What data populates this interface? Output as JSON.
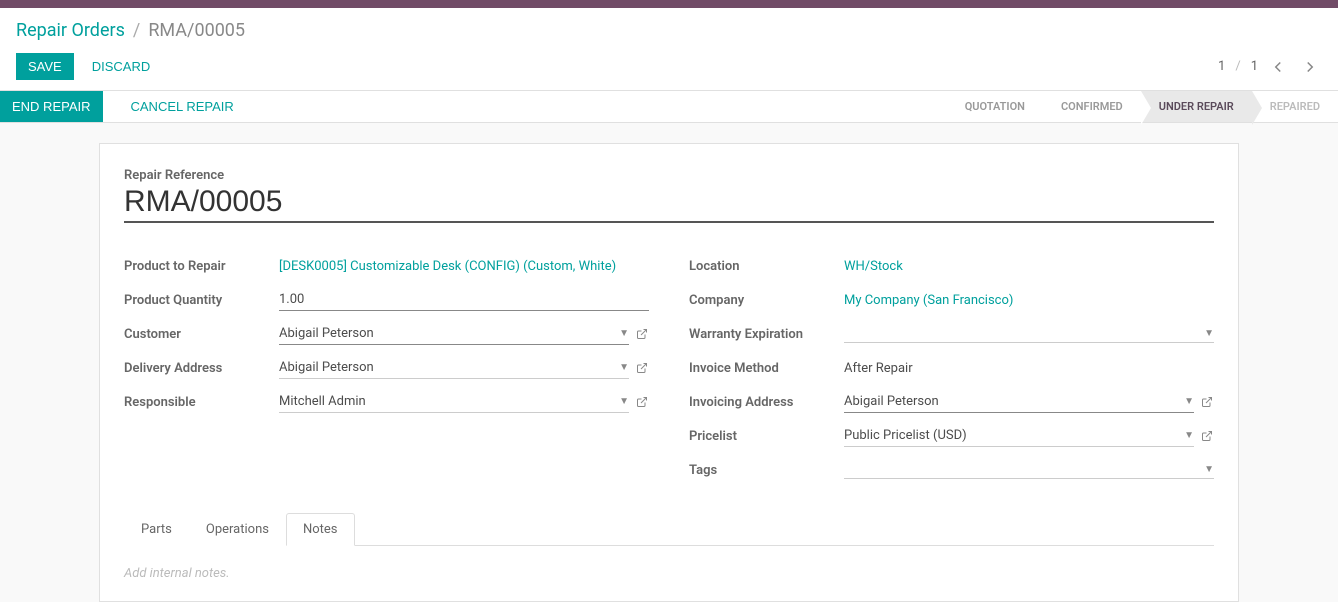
{
  "breadcrumb": {
    "parent": "Repair Orders",
    "sep": "/",
    "current": "RMA/00005"
  },
  "header": {
    "save": "Save",
    "discard": "Discard",
    "pager": {
      "current": "1",
      "sep": "/",
      "total": "1"
    }
  },
  "actions": {
    "end_repair": "End Repair",
    "cancel_repair": "Cancel Repair"
  },
  "status": {
    "quotation": "Quotation",
    "confirmed": "Confirmed",
    "under_repair": "Under Repair",
    "repaired": "Repaired"
  },
  "form": {
    "ref_label": "Repair Reference",
    "ref_value": "RMA/00005",
    "left": {
      "product_to_repair_label": "Product to Repair",
      "product_to_repair_value": "[DESK0005] Customizable Desk (CONFIG) (Custom, White)",
      "product_qty_label": "Product Quantity",
      "product_qty_value": "1.00",
      "customer_label": "Customer",
      "customer_value": "Abigail Peterson",
      "delivery_label": "Delivery Address",
      "delivery_value": "Abigail Peterson",
      "responsible_label": "Responsible",
      "responsible_value": "Mitchell Admin"
    },
    "right": {
      "location_label": "Location",
      "location_value": "WH/Stock",
      "company_label": "Company",
      "company_value": "My Company (San Francisco)",
      "warranty_label": "Warranty Expiration",
      "warranty_value": "",
      "invoice_method_label": "Invoice Method",
      "invoice_method_value": "After Repair",
      "invoicing_addr_label": "Invoicing Address",
      "invoicing_addr_value": "Abigail Peterson",
      "pricelist_label": "Pricelist",
      "pricelist_value": "Public Pricelist (USD)",
      "tags_label": "Tags",
      "tags_value": ""
    }
  },
  "tabs": {
    "parts": "Parts",
    "operations": "Operations",
    "notes": "Notes"
  },
  "notes": {
    "placeholder": "Add internal notes."
  }
}
